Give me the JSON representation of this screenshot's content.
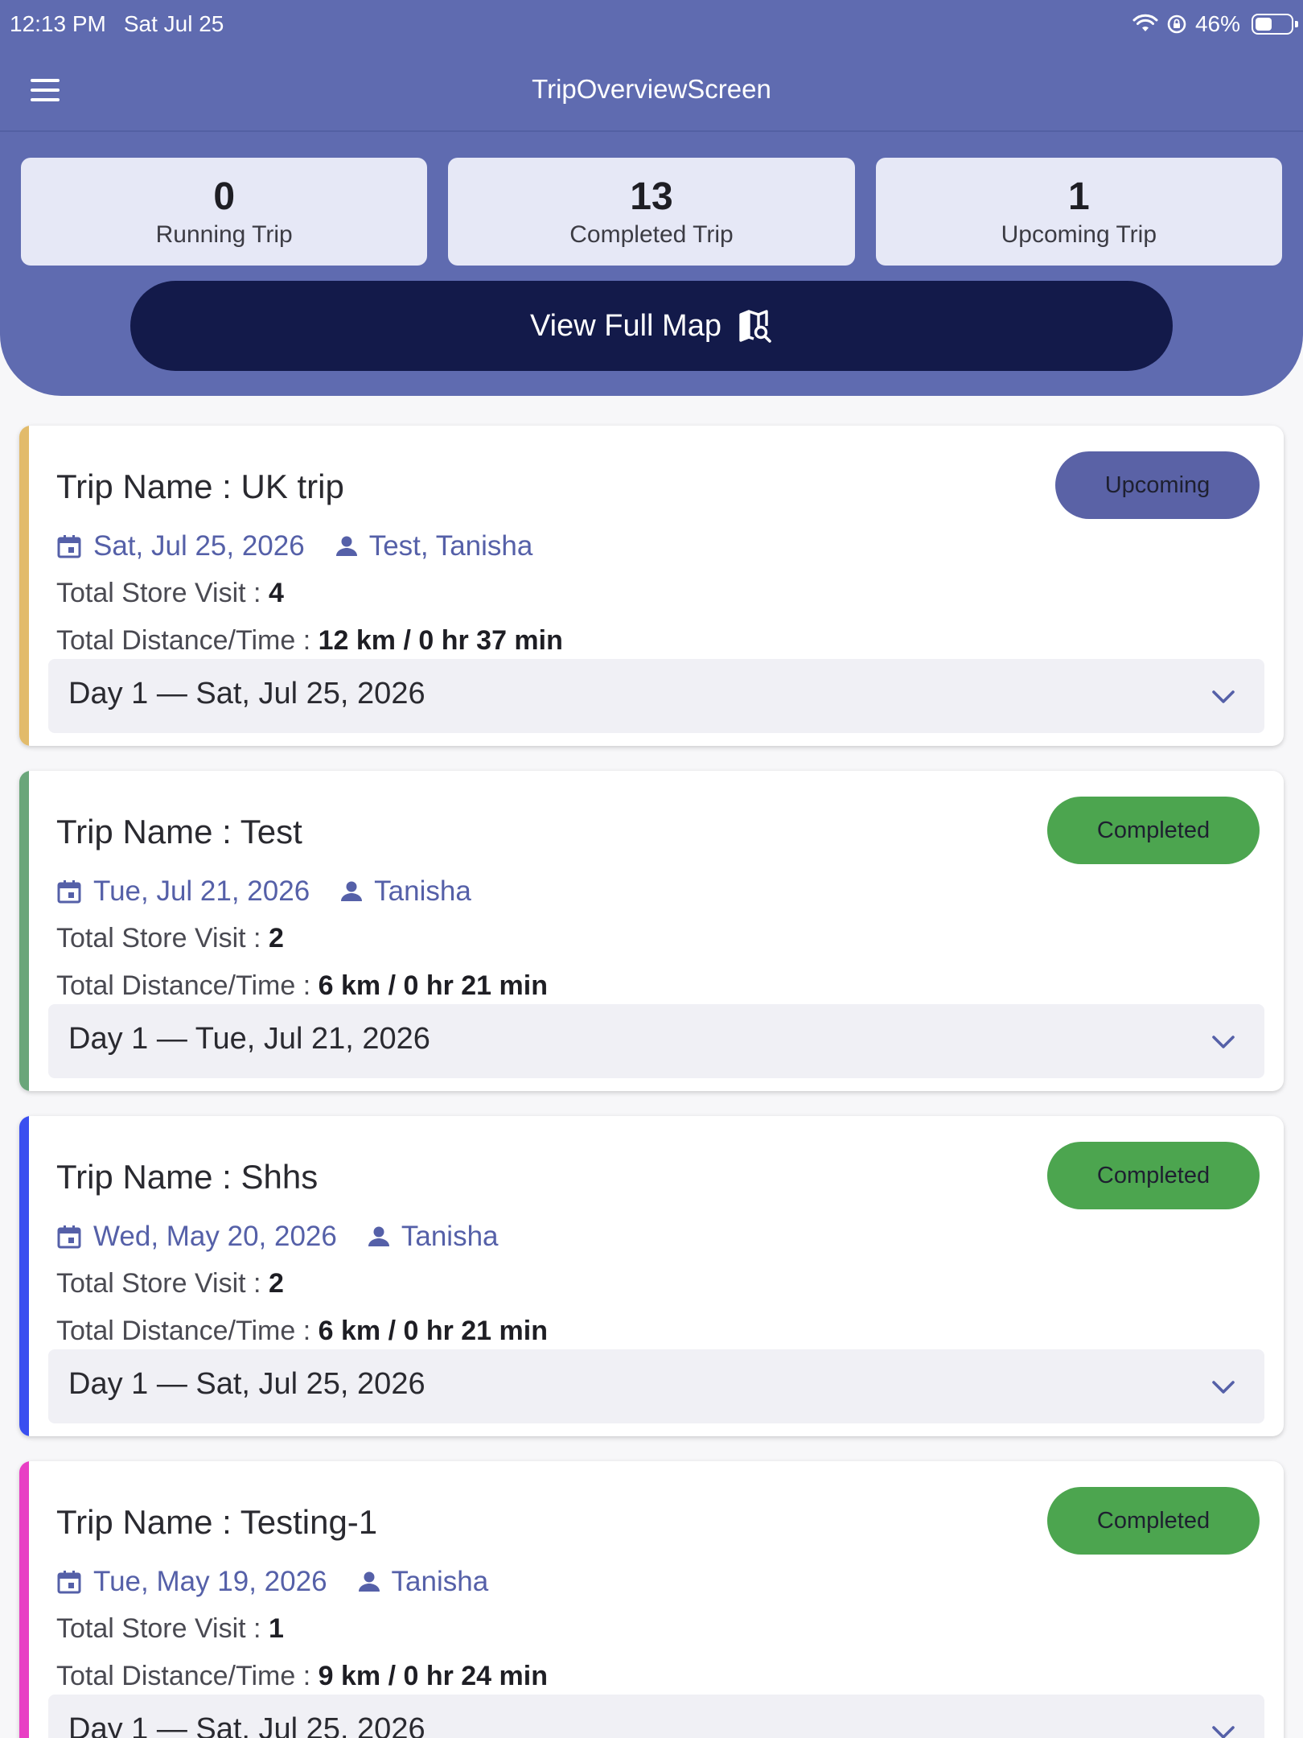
{
  "status_bar": {
    "time": "12:13 PM",
    "date": "Sat Jul 25",
    "battery": "46%"
  },
  "app_bar": {
    "title": "TripOverviewScreen"
  },
  "stats": [
    {
      "value": "0",
      "label": "Running Trip"
    },
    {
      "value": "13",
      "label": "Completed Trip"
    },
    {
      "value": "1",
      "label": "Upcoming Trip"
    }
  ],
  "map_button": {
    "label": "View Full Map"
  },
  "labels": {
    "trip_name_prefix": "Trip Name : ",
    "store_visit": "Total Store Visit : ",
    "distance_time": "Total Distance/Time : "
  },
  "colors": {
    "header": "#5f6bb0",
    "map_button": "#131a4a",
    "upcoming_badge": "#5a62a6",
    "completed_badge": "#4ca54f",
    "meta_text": "#5560a8"
  },
  "trips": [
    {
      "name": "UK trip",
      "status": "Upcoming",
      "date": "Sat, Jul 25, 2026",
      "people": "Test, Tanisha",
      "store_visits": "4",
      "distance_time": "12 km / 0 hr 37 min",
      "day": "Day 1 — Sat, Jul 25, 2026",
      "accent": "#e2bb6b"
    },
    {
      "name": "Test",
      "status": "Completed",
      "date": "Tue, Jul 21, 2026",
      "people": "Tanisha",
      "store_visits": "2",
      "distance_time": "6 km / 0 hr 21 min",
      "day": "Day 1 — Tue, Jul 21, 2026",
      "accent": "#6aa67a"
    },
    {
      "name": "Shhs",
      "status": "Completed",
      "date": "Wed, May 20, 2026",
      "people": "Tanisha",
      "store_visits": "2",
      "distance_time": "6 km / 0 hr 21 min",
      "day": "Day 1 — Sat, Jul 25, 2026",
      "accent": "#3a4ff0"
    },
    {
      "name": "Testing-1",
      "status": "Completed",
      "date": "Tue, May 19, 2026",
      "people": "Tanisha",
      "store_visits": "1",
      "distance_time": "9 km / 0 hr 24 min",
      "day": "Day 1 — Sat, Jul 25, 2026",
      "accent": "#e83fc4"
    }
  ]
}
